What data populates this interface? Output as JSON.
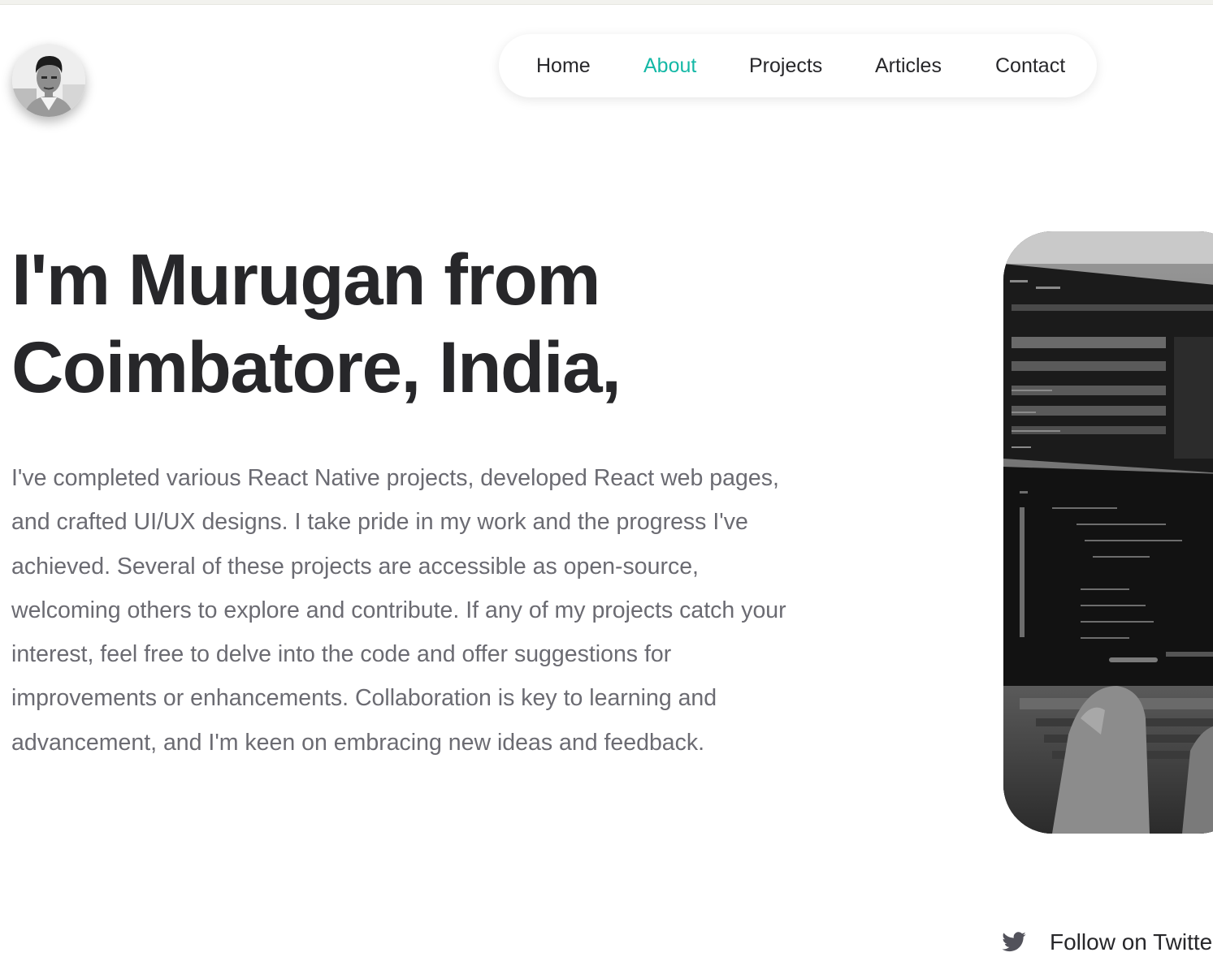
{
  "header": {
    "avatar_alt": "Profile photo"
  },
  "nav": {
    "items": [
      {
        "label": "Home",
        "active": false
      },
      {
        "label": "About",
        "active": true
      },
      {
        "label": "Projects",
        "active": false
      },
      {
        "label": "Articles",
        "active": false
      },
      {
        "label": "Contact",
        "active": false
      }
    ]
  },
  "hero": {
    "title": "I'm Murugan from Coimbatore, India,",
    "body": "I've completed various React Native projects, developed React web pages, and crafted UI/UX designs. I take pride in my work and the progress I've achieved. Several of these projects are accessible as open-source, welcoming others to explore and contribute. If any of my projects catch your interest, feel free to delve into the code and offer suggestions for improvements or enhancements. Collaboration is key to learning and advancement, and I'm keen on embracing new ideas and feedback."
  },
  "social": {
    "twitter_label": "Follow on Twitter",
    "twitter_icon": "twitter-icon"
  },
  "colors": {
    "accent": "#14b8a6",
    "text_primary": "#27272a",
    "text_secondary": "#6b6b72"
  }
}
